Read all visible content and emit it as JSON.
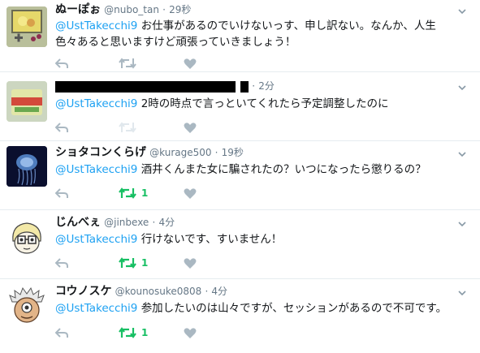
{
  "colors": {
    "mention": "#1da1f2",
    "retweet_active": "#17bf63",
    "icon_gray": "#aab8c2",
    "icon_light": "#ccd6dd"
  },
  "tweets": [
    {
      "name": "ぬーぽぉ",
      "handle": "@nubo_tan",
      "time": "29秒",
      "mention": "@UstTakecchi9",
      "text": "お仕事があるのでいけないっす、申し訳ない。なんか、人生",
      "text2": "色々あると思いますけど頑張っていきましょう！",
      "retweets": "",
      "avatar_icon": "gameboy-avatar"
    },
    {
      "name": "",
      "handle": "",
      "time": "2分",
      "mention": "@UstTakecchi9",
      "text": "2時の時点で言っといてくれたら予定調整したのに",
      "retweets": "",
      "avatar_icon": "can-avatar"
    },
    {
      "name": "ショタコンくらげ",
      "handle": "@kurage500",
      "time": "19秒",
      "mention": "@UstTakecchi9",
      "text": "酒井くんまた女に騙されたの？いつになったら懲りるの？",
      "retweets": "1",
      "avatar_icon": "jellyfish-avatar"
    },
    {
      "name": "じんべぇ",
      "handle": "@jinbexe",
      "time": "4分",
      "mention": "@UstTakecchi9",
      "text": "行けないです、すいません！",
      "retweets": "1",
      "avatar_icon": "cartoon-avatar"
    },
    {
      "name": "コウノスケ",
      "handle": "@kounosuke0808",
      "time": "4分",
      "mention": "@UstTakecchi9",
      "text": "参加したいのは山々ですが、セッションがあるので不可です。",
      "retweets": "1",
      "avatar_icon": "old-man-avatar"
    }
  ]
}
